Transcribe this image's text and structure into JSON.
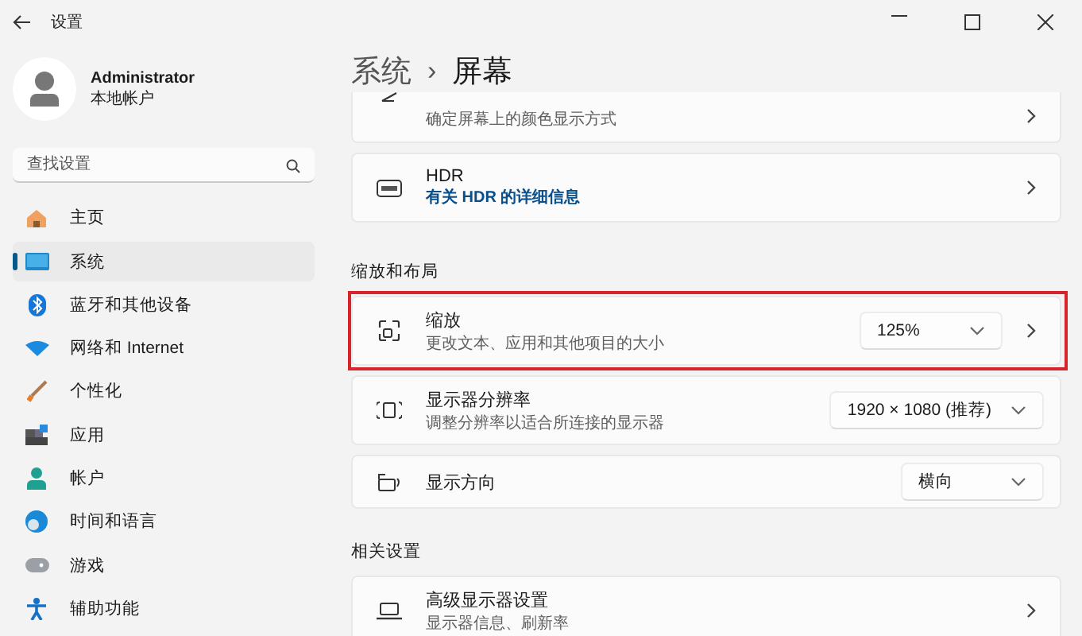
{
  "window": {
    "title": "设置"
  },
  "account": {
    "name": "Administrator",
    "type": "本地帐户"
  },
  "search": {
    "placeholder": "查找设置"
  },
  "nav": [
    {
      "kind": "home",
      "label": "主页",
      "selected": false
    },
    {
      "kind": "system",
      "label": "系统",
      "selected": true
    },
    {
      "kind": "bluetooth",
      "label": "蓝牙和其他设备",
      "selected": false
    },
    {
      "kind": "network",
      "label": "网络和 Internet",
      "selected": false
    },
    {
      "kind": "personalize",
      "label": "个性化",
      "selected": false
    },
    {
      "kind": "apps",
      "label": "应用",
      "selected": false
    },
    {
      "kind": "accounts",
      "label": "帐户",
      "selected": false
    },
    {
      "kind": "time",
      "label": "时间和语言",
      "selected": false
    },
    {
      "kind": "gaming",
      "label": "游戏",
      "selected": false
    },
    {
      "kind": "accessibility",
      "label": "辅助功能",
      "selected": false
    }
  ],
  "breadcrumb": {
    "parent": "系统",
    "separator": "›",
    "current": "屏幕"
  },
  "sections": [
    {
      "cards": [
        {
          "kind": "partial",
          "subtitle": "确定屏幕上的颜色显示方式",
          "highlighted": false
        },
        {
          "kind": "link",
          "title": "HDR",
          "link": "有关 HDR 的详细信息",
          "highlighted": false
        }
      ]
    },
    {
      "heading": "缩放和布局",
      "cards": [
        {
          "kind": "dropdown_link",
          "title": "缩放",
          "subtitle": "更改文本、应用和其他项目的大小",
          "value": "125%",
          "highlighted": true
        },
        {
          "kind": "dropdown",
          "title": "显示器分辨率",
          "subtitle": "调整分辨率以适合所连接的显示器",
          "value": "1920 × 1080 (推荐)",
          "highlighted": false
        },
        {
          "kind": "dropdown",
          "title": "显示方向",
          "value": "横向",
          "highlighted": false
        }
      ]
    },
    {
      "heading": "相关设置",
      "cards": [
        {
          "kind": "link",
          "title": "高级显示器设置",
          "subtitle": "显示器信息、刷新率",
          "highlighted": false
        }
      ]
    }
  ]
}
